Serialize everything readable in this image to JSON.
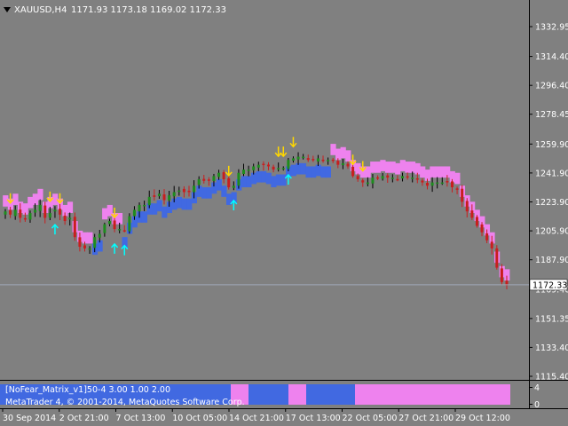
{
  "header": {
    "symbol_label": "XAUUSD,H4",
    "ohlc_label": "1171.93 1173.18 1169.02 1172.33"
  },
  "colors": {
    "background": "#808080",
    "bull": "#1e8c1e",
    "bear": "#c81e1e",
    "band_blue": "#4169e1",
    "band_pink": "#ee82ee",
    "arrow_down": "#ffd700",
    "arrow_up": "#00ffff",
    "price_line": "#a0a8b8"
  },
  "indicator": {
    "label": "[NoFear_Matrix_v1]50-4 3.00 1.00 2.00",
    "copyright": "MetaTrader 4, © 2001-2014, MetaQuotes Software Corp.",
    "scale_top": "4",
    "scale_bottom": "0"
  },
  "chart_data": {
    "type": "candlestick",
    "current_price": 1172.33,
    "current_price_label": "1172.33",
    "y_ticks": [
      "1332.95",
      "1314.40",
      "1296.40",
      "1278.45",
      "1259.90",
      "1241.90",
      "1223.90",
      "1205.90",
      "1187.90",
      "1169.40",
      "1151.35",
      "1133.40",
      "1115.40"
    ],
    "x_ticks": [
      "30 Sep 2014",
      "2 Oct 21:00",
      "7 Oct 13:00",
      "10 Oct 05:00",
      "14 Oct 21:00",
      "17 Oct 13:00",
      "22 Oct 05:00",
      "27 Oct 21:00",
      "29 Oct 12:00"
    ],
    "close_path": [
      1218,
      1216,
      1219,
      1214,
      1213,
      1217,
      1219,
      1222,
      1214,
      1217,
      1219,
      1216,
      1212,
      1214,
      1202,
      1196,
      1195,
      1195,
      1202,
      1204,
      1210,
      1212,
      1207,
      1207,
      1206,
      1215,
      1219,
      1222,
      1222,
      1227,
      1227,
      1229,
      1225,
      1228,
      1230,
      1231,
      1230,
      1230,
      1234,
      1238,
      1237,
      1237,
      1240,
      1242,
      1238,
      1233,
      1234,
      1242,
      1244,
      1244,
      1246,
      1247,
      1247,
      1246,
      1244,
      1245,
      1245,
      1250,
      1251,
      1252,
      1252,
      1250,
      1250,
      1251,
      1250,
      1250,
      1250,
      1247,
      1248,
      1246,
      1240,
      1238,
      1236,
      1236,
      1239,
      1239,
      1240,
      1239,
      1239,
      1238,
      1240,
      1239,
      1239,
      1238,
      1236,
      1234,
      1236,
      1236,
      1236,
      1236,
      1233,
      1232,
      1224,
      1218,
      1214,
      1209,
      1205,
      1200,
      1195,
      1183,
      1174,
      1172
    ],
    "blue_band_pink_series": "NoFear_Matrix_v1"
  }
}
